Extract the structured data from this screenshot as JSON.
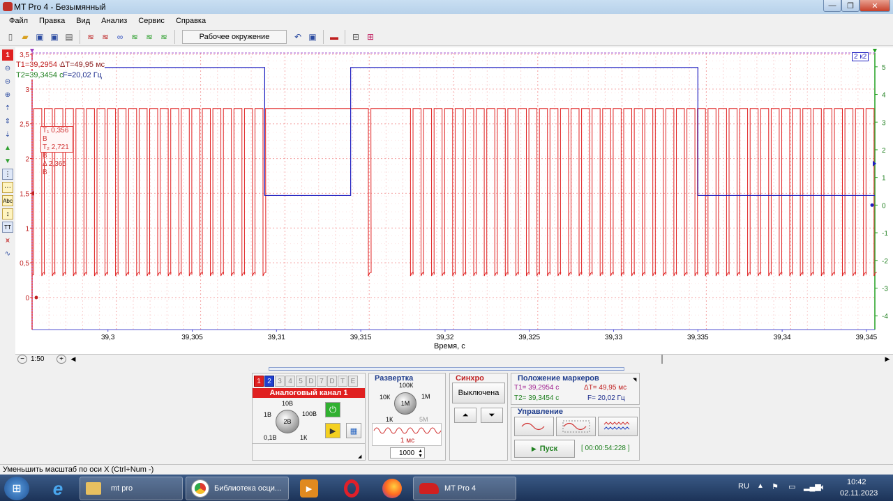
{
  "window": {
    "title": "MT Pro 4 - Безымянный"
  },
  "menu": [
    "Файл",
    "Правка",
    "Вид",
    "Анализ",
    "Сервис",
    "Справка"
  ],
  "toolbar": {
    "workspace_label": "Рабочее окружение"
  },
  "left_tools": {
    "channel_badge": "1"
  },
  "scope": {
    "channel2_label": "2 к2",
    "markers": {
      "t1": "T1=39,2954 с",
      "dt": "ΔT=49,95 мс",
      "t2": "T2=39,3454 с",
      "f": "F=20,02 Гц"
    },
    "cursor_box": {
      "row1": "T₁  0,356 В",
      "row2": "T₂  2,721 В",
      "row3": "Δ   2,365 В"
    },
    "x_label": "Время, с",
    "x_ticks": [
      "39,3",
      "39,305",
      "39,31",
      "39,315",
      "39,32",
      "39,325",
      "39,33",
      "39,335",
      "39,34",
      "39,345"
    ],
    "y_left_ticks": [
      "3,5",
      "3",
      "2,5",
      "2",
      "1,5",
      "1",
      "0,5",
      "0"
    ],
    "y_right_ticks": [
      "5",
      "4",
      "3",
      "2",
      "1",
      "0",
      "-1",
      "-2",
      "-3",
      "-4"
    ],
    "colors": {
      "ch1": "#e02020",
      "ch2": "#2020c0",
      "grid": "#f08080"
    }
  },
  "scroll": {
    "zoom_label": "1:50"
  },
  "channel_panel": {
    "tabs": [
      "1",
      "2",
      "3",
      "4",
      "5",
      "D",
      "7",
      "D",
      "T",
      "E"
    ],
    "title": "Аналоговый канал 1",
    "knob_labels": {
      "top": "10В",
      "left": "1В",
      "right": "100В",
      "bl": "0,1В",
      "br": "1К",
      "center": "2В"
    }
  },
  "sweep_panel": {
    "title": "Развертка",
    "knob_labels": {
      "top": "100К",
      "left": "10К",
      "right": "1М",
      "bl": "1К",
      "br": "5М",
      "center": "1М"
    },
    "time_label": "1 мс",
    "points_value": "1000"
  },
  "sync_panel": {
    "title": "Синхро",
    "mode": "Выключена"
  },
  "markers_panel": {
    "title": "Положение маркеров",
    "t1": "T1= 39,2954 с",
    "dt": "ΔT= 49,95 мс",
    "t2": "T2= 39,3454 с",
    "f": "F= 20,02 Гц"
  },
  "control_panel": {
    "title": "Управление",
    "start_label": "Пуск",
    "timer": "[ 00:00:54:228 ]"
  },
  "status_bar": {
    "text": "Уменьшить масштаб по оси X (Ctrl+Num -)"
  },
  "taskbar": {
    "tasks": [
      "mt pro",
      "Библиотека осци...",
      "MT Pro 4"
    ],
    "lang": "RU",
    "time": "10:42",
    "date": "02.11.2023"
  },
  "chart_data": {
    "type": "line",
    "xlabel": "Время, с",
    "xlim": [
      39.2955,
      39.3455
    ],
    "ylim_left": [
      0,
      3.5
    ],
    "ylim_right": [
      -4.5,
      5.5
    ],
    "series": [
      {
        "name": "1",
        "description_values": {
          "high": 2.72,
          "low": 0.33,
          "period": 0.000625
        }
      },
      {
        "name": "2",
        "segments": [
          [
            39.2955,
            39.3093,
            5.0
          ],
          [
            39.3093,
            39.3144,
            0.35
          ],
          [
            39.3144,
            39.335,
            5.0
          ],
          [
            39.335,
            39.3455,
            0.35
          ]
        ]
      }
    ],
    "gaps_ch1": [
      [
        39.3093,
        39.3144
      ],
      [
        39.315,
        39.3174
      ]
    ]
  }
}
